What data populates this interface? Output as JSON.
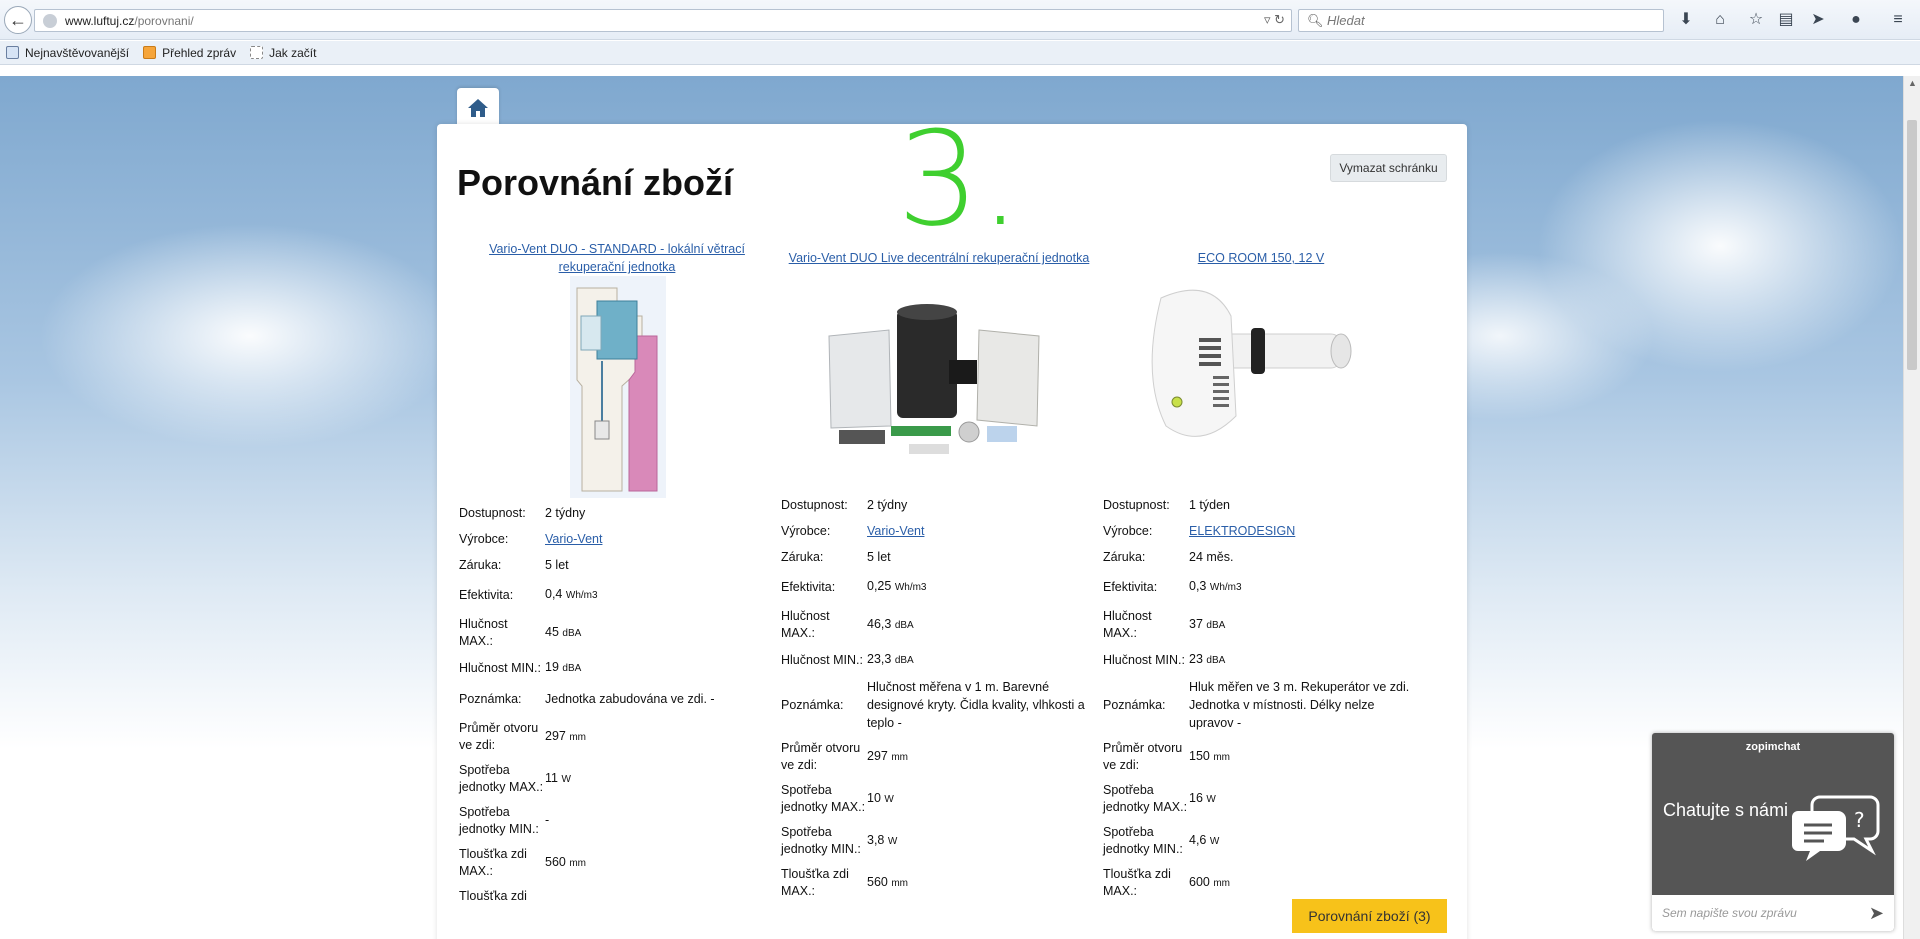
{
  "browser": {
    "url_host": "www.luftuj.cz",
    "url_path": "/porovnani/",
    "search_placeholder": "Hledat",
    "bookmarks": [
      "Nejnavštěvovanější",
      "Přehled zpráv",
      "Jak začít"
    ]
  },
  "page": {
    "title": "Porovnání zboží",
    "big_number": "3.",
    "clear_label": "Vymazat schránku",
    "compare_label": "Porovnání zboží (3)"
  },
  "labels": {
    "availability": "Dostupnost:",
    "maker": "Výrobce:",
    "warranty": "Záruka:",
    "efficiency": "Efektivita:",
    "noise_max": "Hlučnost MAX.:",
    "noise_min": "Hlučnost MIN.:",
    "note": "Poznámka:",
    "diameter": "Průměr otvoru ve zdi:",
    "power_max": "Spotřeba jednotky MAX.:",
    "power_min": "Spotřeba jednotky MIN.:",
    "wall_max": "Tloušťka zdi MAX.:",
    "wall_min": "Tloušťka zdi"
  },
  "products": [
    {
      "name": "Vario-Vent DUO - STANDARD - lokální větrací rekuperační jednotka",
      "availability": "2 týdny",
      "maker": "Vario-Vent",
      "warranty": "5 let",
      "efficiency": "0,4",
      "efficiency_unit": "Wh/m3",
      "noise_max": "45",
      "noise_max_unit": "dBA",
      "noise_min": "19",
      "noise_min_unit": "dBA",
      "note": "Jednotka zabudována ve zdi. -",
      "diameter": "297",
      "diameter_unit": "mm",
      "power_max": "11",
      "power_max_unit": "W",
      "power_min": "-",
      "power_min_unit": "",
      "wall_max": "560",
      "wall_max_unit": "mm"
    },
    {
      "name": "Vario-Vent DUO Live decentrální rekuperační jednotka",
      "availability": "2 týdny",
      "maker": "Vario-Vent",
      "warranty": "5 let",
      "efficiency": "0,25",
      "efficiency_unit": "Wh/m3",
      "noise_max": "46,3",
      "noise_max_unit": "dBA",
      "noise_min": "23,3",
      "noise_min_unit": "dBA",
      "note": "Hlučnost měřena v 1 m. Barevné designové kryty. Čidla kvality, vlhkosti a teplo -",
      "diameter": "297",
      "diameter_unit": "mm",
      "power_max": "10",
      "power_max_unit": "W",
      "power_min": "3,8",
      "power_min_unit": "W",
      "wall_max": "560",
      "wall_max_unit": "mm"
    },
    {
      "name": "ECO ROOM 150, 12 V",
      "availability": "1 týden",
      "maker": "ELEKTRODESIGN",
      "warranty": "24 měs.",
      "efficiency": "0,3",
      "efficiency_unit": "Wh/m3",
      "noise_max": "37",
      "noise_max_unit": "dBA",
      "noise_min": "23",
      "noise_min_unit": "dBA",
      "note": "Hluk měřen ve 3 m. Rekuperátor ve zdi. Jednotka v místnosti. Délky nelze upravov -",
      "diameter": "150",
      "diameter_unit": "mm",
      "power_max": "16",
      "power_max_unit": "W",
      "power_min": "4,6",
      "power_min_unit": "W",
      "wall_max": "600",
      "wall_max_unit": "mm"
    }
  ],
  "chat": {
    "brand": "zopimchat",
    "message": "Chatujte s námi",
    "input_placeholder": "Sem napište svou zprávu"
  }
}
